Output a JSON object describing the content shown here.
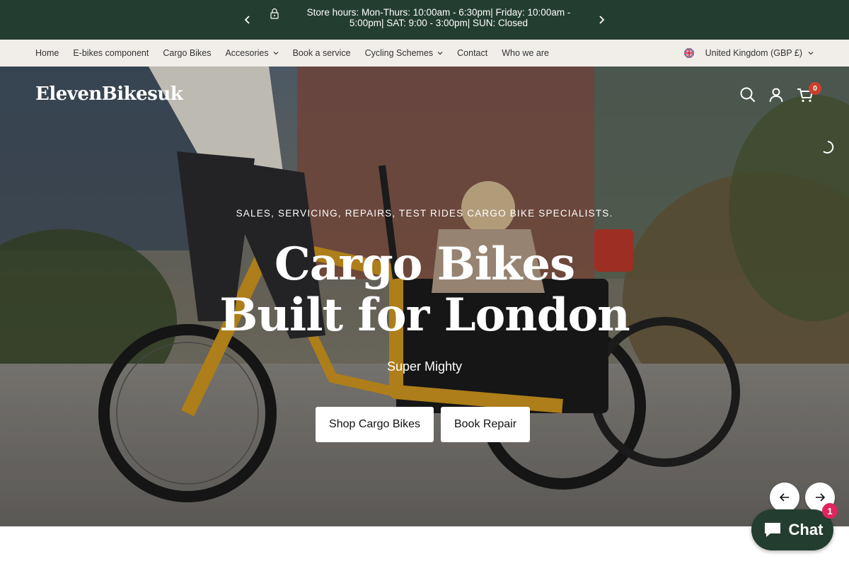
{
  "announcement": {
    "text": "Store hours: Mon-Thurs: 10:00am - 6:30pm| Friday: 10:00am - 5:00pm| SAT: 9:00 - 3:00pm| SUN: Closed",
    "prev_icon": "chevron-left-icon",
    "next_icon": "chevron-right-icon",
    "lock_icon": "lock-icon"
  },
  "nav": {
    "items": [
      {
        "label": "Home"
      },
      {
        "label": "E-bikes component"
      },
      {
        "label": "Cargo Bikes"
      },
      {
        "label": "Accesories"
      },
      {
        "label": "Book a service"
      },
      {
        "label": "Cycling Schemes"
      },
      {
        "label": "Contact"
      },
      {
        "label": "Who we are"
      }
    ],
    "country": "United Kingdom (GBP £)"
  },
  "header": {
    "logo": "ElevenBikesuk",
    "cart_count": "0"
  },
  "hero": {
    "subtitle": "SALES, SERVICING, REPAIRS, TEST RIDES CARGO BIKE SPECIALISTS.",
    "headline": "Cargo Bikes Built for London",
    "tagline": "Super Mighty",
    "primary_button": "Shop Cargo Bikes",
    "secondary_button": "Book Repair"
  },
  "chat": {
    "label": "Chat",
    "badge": "1"
  },
  "colors": {
    "brand_green": "#243d31",
    "nav_bg": "#f1eeea",
    "cart_badge": "#c9402f",
    "chat_badge": "#e0245e"
  }
}
